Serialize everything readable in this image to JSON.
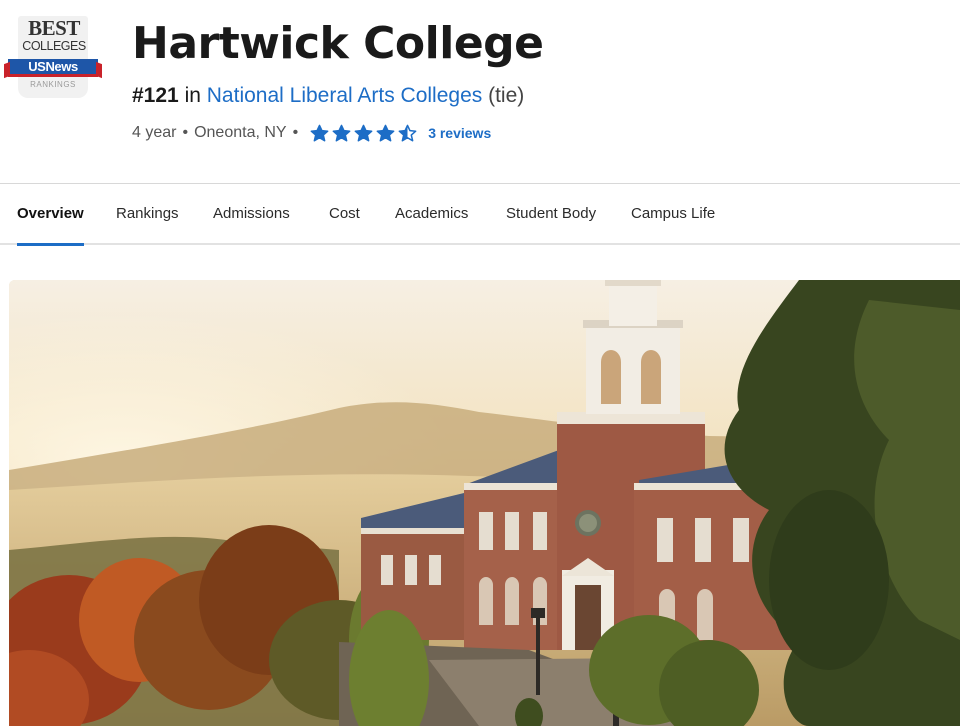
{
  "badge": {
    "line1": "BEST",
    "line2": "COLLEGES",
    "brand": "USNews",
    "line3": "RANKINGS"
  },
  "college": {
    "name": "Hartwick College",
    "rank": "#121",
    "rank_in": "in",
    "category": "National Liberal Arts Colleges",
    "tie": "(tie)",
    "type": "4 year",
    "separator": "•",
    "location": "Oneonta, NY",
    "rating_stars": 4.5,
    "reviews": "3 reviews"
  },
  "nav": {
    "tabs": [
      {
        "label": "Overview",
        "active": true
      },
      {
        "label": "Rankings",
        "active": false
      },
      {
        "label": "Admissions",
        "active": false
      },
      {
        "label": "Cost",
        "active": false
      },
      {
        "label": "Academics",
        "active": false
      },
      {
        "label": "Student Body",
        "active": false
      },
      {
        "label": "Campus Life",
        "active": false
      }
    ]
  },
  "colors": {
    "link": "#1d6dc6",
    "active_tab_underline": "#1d6dc6",
    "star": "#1d6dc6",
    "brand_blue": "#1e56a8",
    "brand_red": "#c9222a"
  },
  "hero": {
    "icon": "campus-photo"
  }
}
